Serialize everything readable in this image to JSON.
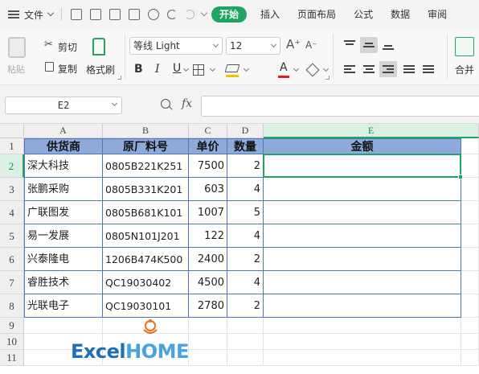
{
  "menubar": {
    "file_label": "文件",
    "tabs": [
      {
        "label": "开始",
        "active": true
      },
      {
        "label": "插入",
        "active": false
      },
      {
        "label": "页面布局",
        "active": false
      },
      {
        "label": "公式",
        "active": false
      },
      {
        "label": "数据",
        "active": false
      },
      {
        "label": "审阅",
        "active": false
      }
    ]
  },
  "ribbon": {
    "paste_label": "粘贴",
    "cut_label": "剪切",
    "copy_label": "复制",
    "format_painter_label": "格式刷",
    "font_name": "等线 Light",
    "font_size": "12",
    "merge_label": "合并",
    "fill_color": "#f2c200",
    "font_color": "#e02020"
  },
  "formula_bar": {
    "name_box": "E2",
    "fx_label": "fx",
    "formula": ""
  },
  "sheet": {
    "columns": [
      "A",
      "B",
      "C",
      "D",
      "E"
    ],
    "selected_column": "E",
    "rows": [
      "1",
      "2",
      "3",
      "4",
      "5",
      "6",
      "7",
      "8",
      "9",
      "10",
      "11"
    ],
    "selected_row": "2",
    "selected_cell": "E2",
    "header_fill": "#8eaadb",
    "headers": [
      "供货商",
      "原厂料号",
      "单价",
      "数量",
      "金额"
    ],
    "data": [
      [
        "深大科技",
        "0805B221K251",
        "7500",
        "2",
        ""
      ],
      [
        "张鹏采购",
        "0805B331K201",
        "603",
        "4",
        ""
      ],
      [
        "广联图发",
        "0805B681K101",
        "1007",
        "5",
        ""
      ],
      [
        "易一发展",
        "0805N101J201",
        "122",
        "4",
        ""
      ],
      [
        "兴泰隆电",
        "1206B474K500",
        "2400",
        "2",
        ""
      ],
      [
        "睿胜技术",
        "QC19030402",
        "4500",
        "4",
        ""
      ],
      [
        "光联电子",
        "QC19030101",
        "2780",
        "2",
        ""
      ]
    ]
  },
  "logo": {
    "excel": "Excel",
    "home": "HOME"
  }
}
